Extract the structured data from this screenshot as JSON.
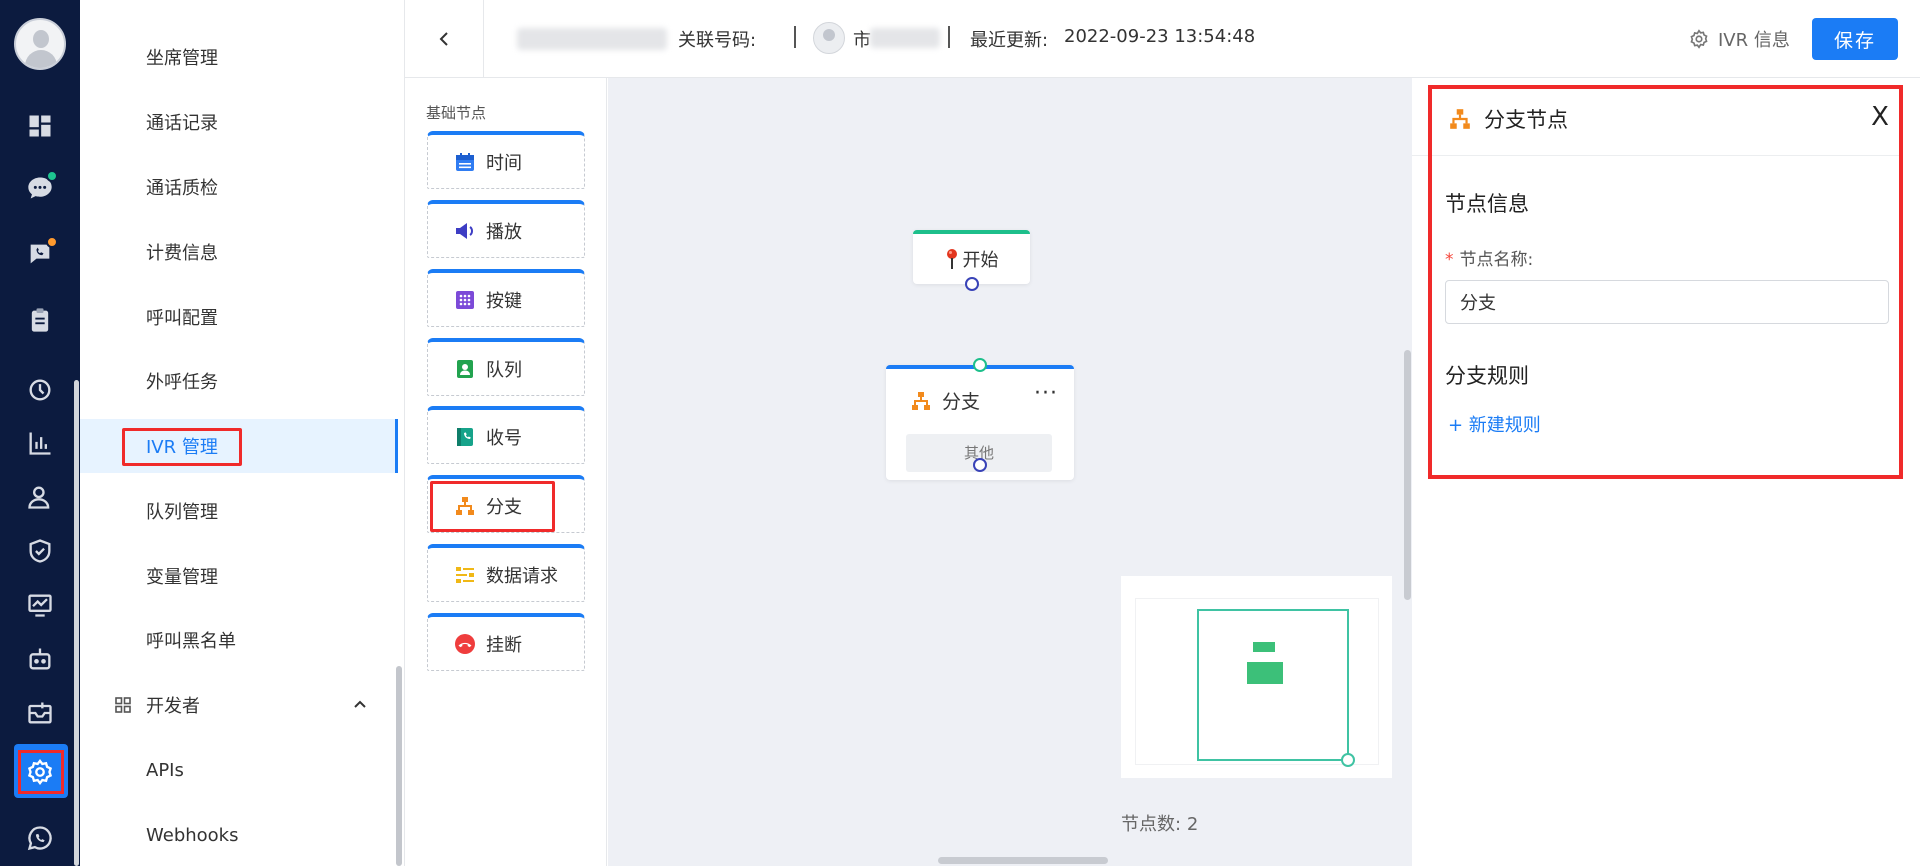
{
  "colors": {
    "rail_bg": "#0c1b3f",
    "accent": "#1b7cf5",
    "highlight_frame": "#f02a2a",
    "start_node_top": "#1dbf8b",
    "minimap_green": "#3cc079"
  },
  "rail": {
    "icons": [
      "dashboard-icon",
      "chat-icon",
      "phone-chat-icon",
      "clipboard-icon",
      "history-icon",
      "bar-chart-icon",
      "contacts-icon",
      "shield-icon",
      "monitor-chart-icon",
      "robot-icon",
      "inbox-icon",
      "gear-icon",
      "whatsapp-icon"
    ],
    "badges": {
      "chat": "#1dc48f",
      "phone": "#ff9a2e"
    }
  },
  "menu": {
    "items": [
      "坐席管理",
      "通话记录",
      "通话质检",
      "计费信息",
      "呼叫配置",
      "外呼任务",
      "IVR 管理",
      "队列管理",
      "变量管理",
      "呼叫黑名单"
    ],
    "active": "IVR 管理",
    "group": "开发者",
    "group_items": [
      "APIs",
      "Webhooks"
    ]
  },
  "header": {
    "related_number_label": "关联号码:",
    "related_user_text": "市",
    "updated_label": "最近更新:",
    "updated_value": "2022-09-23 13:54:48",
    "ivr_info_label": "IVR 信息",
    "save_label": "保存"
  },
  "palette": {
    "title": "基础节点",
    "items": [
      {
        "label": "时间",
        "icon": "calendar-icon"
      },
      {
        "label": "播放",
        "icon": "speaker-icon"
      },
      {
        "label": "按键",
        "icon": "keypad-icon"
      },
      {
        "label": "队列",
        "icon": "queue-icon"
      },
      {
        "label": "收号",
        "icon": "phone-book-icon"
      },
      {
        "label": "分支",
        "icon": "branch-icon"
      },
      {
        "label": "数据请求",
        "icon": "data-request-icon"
      },
      {
        "label": "挂断",
        "icon": "hang-up-icon"
      }
    ]
  },
  "canvas": {
    "start_node": "开始",
    "branch_node": "分支",
    "branch_more": "···",
    "branch_other": "其他",
    "node_count_label": "节点数:",
    "node_count": "2"
  },
  "panel": {
    "title": "分支节点",
    "close": "X",
    "section_info": "节点信息",
    "required_mark": "*",
    "name_label": "节点名称:",
    "name_value": "分支",
    "section_rules": "分支规则",
    "add_rule": "+ 新建规则"
  }
}
